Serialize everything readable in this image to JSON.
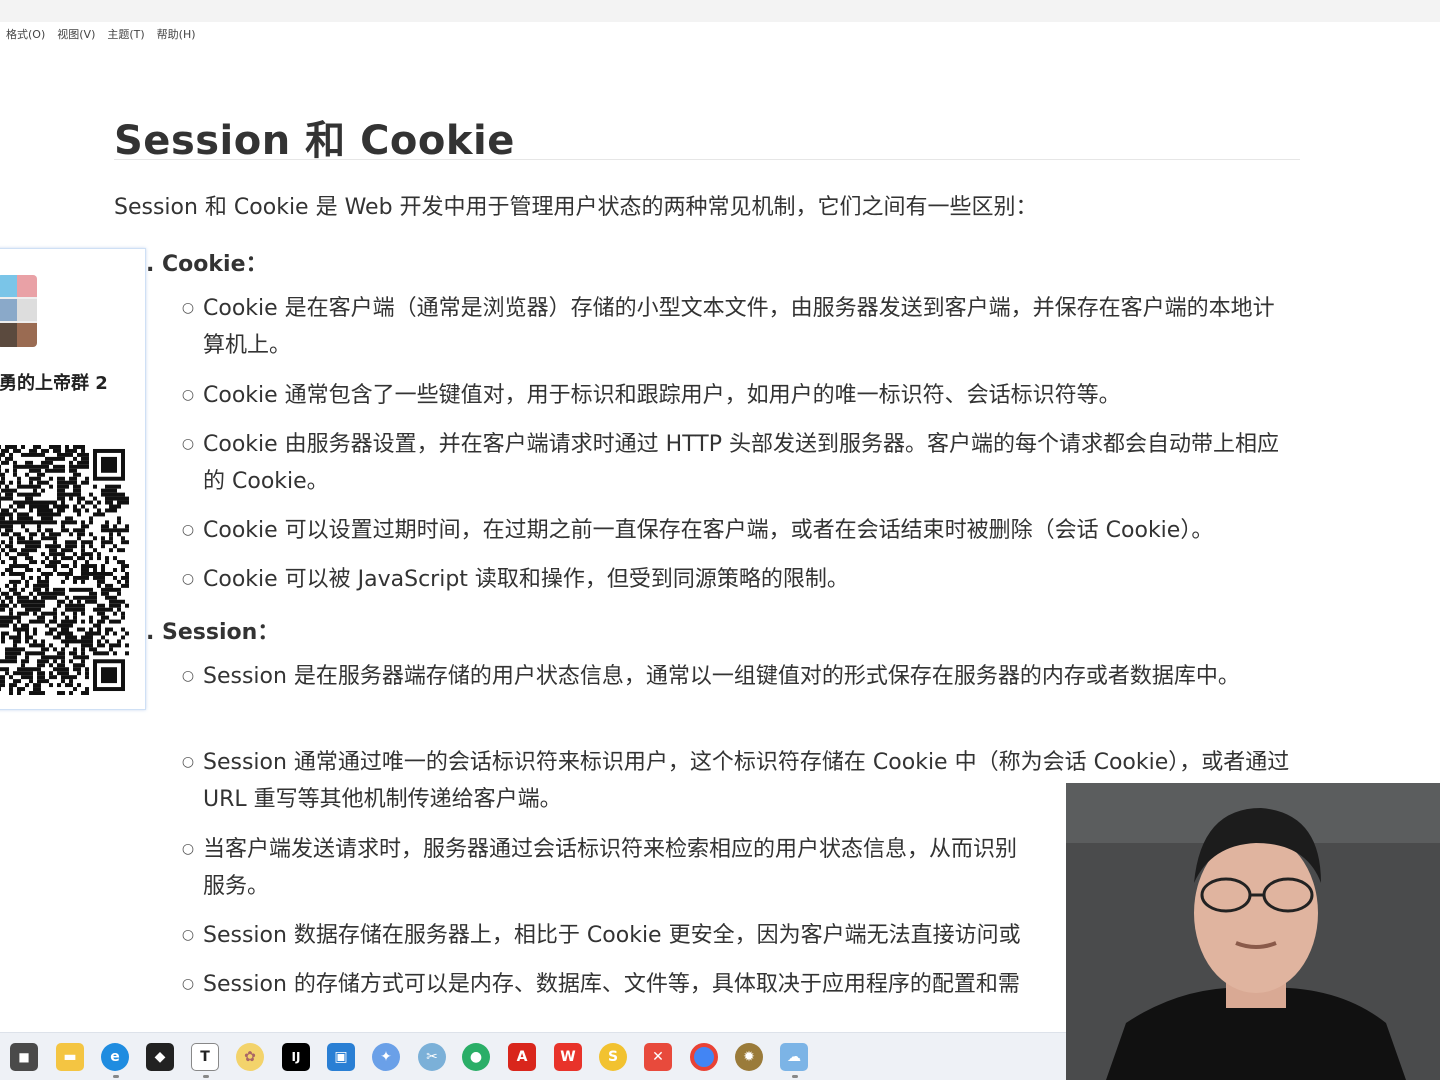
{
  "menu": [
    "格式(O)",
    "视图(V)",
    "主题(T)",
    "帮助(H)"
  ],
  "doc": {
    "title": "Session 和 Cookie",
    "intro": "Session 和 Cookie 是 Web 开发中用于管理用户状态的两种常见机制，它们之间有一些区别：",
    "cookie_heading": ". Cookie：",
    "cookie_items": [
      "Cookie 是在客户端（通常是浏览器）存储的小型文本文件，由服务器发送到客户端，并保存在客户端的本地计算机上。",
      "Cookie 通常包含了一些键值对，用于标识和跟踪用户，如用户的唯一标识符、会话标识符等。",
      "Cookie 由服务器设置，并在客户端请求时通过 HTTP 头部发送到服务器。客户端的每个请求都会自动带上相应的 Cookie。",
      "Cookie 可以设置过期时间，在过期之前一直保存在客户端，或者在会话结束时被删除（会话 Cookie）。",
      "Cookie 可以被 JavaScript 读取和操作，但受到同源策略的限制。"
    ],
    "session_heading": ". Session：",
    "session_items": [
      "Session 是在服务器端存储的用户状态信息，通常以一组键值对的形式保存在服务器的内存或者数据库中。",
      "Session 通常通过唯一的会话标识符来标识用户，这个标识符存储在 Cookie 中（称为会话 Cookie），或者通过 URL 重写等其他机制传递给客户端。",
      "当客户端发送请求时，服务器通过会话标识符来检索相应的用户状态信息，从而识别",
      "服务。",
      "Session 数据存储在服务器上，相比于 Cookie 更安全，因为客户端无法直接访问或",
      "Session 的存储方式可以是内存、数据库、文件等，具体取决于应用程序的配置和需"
    ]
  },
  "qr_card": {
    "group_name": "勇的上帝群 2"
  },
  "taskbar": {
    "icons": [
      "start-icon",
      "file-explorer-icon",
      "edge-icon",
      "unity-icon",
      "typora-icon",
      "sunflower-icon",
      "jetbrains-icon",
      "snipaste-icon",
      "photos-icon",
      "clip-icon",
      "wechat-icon",
      "acrobat-icon",
      "wps-icon",
      "sogou-icon",
      "xmind-icon",
      "chrome-icon",
      "fruit-icon",
      "cloud-icon"
    ],
    "colors": {
      "edge": "#1f8ce0",
      "jetbrains": "#000000",
      "acrobat": "#d9261c",
      "wps": "#e8332a",
      "chrome": "#4285f4"
    }
  }
}
